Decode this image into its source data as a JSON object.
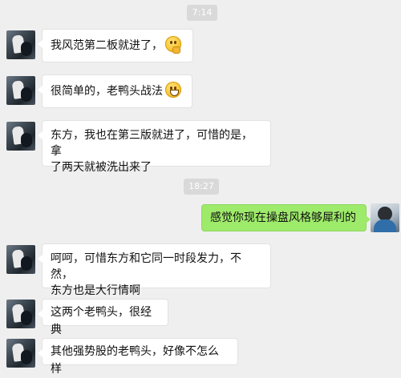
{
  "timestamps": [
    "7:14",
    "18:27"
  ],
  "messages": [
    {
      "sender": "friend",
      "text": "我风范第二板就进了，",
      "emoji": "thinking-face-icon"
    },
    {
      "sender": "friend",
      "text": "很简单的，老鸭头战法",
      "emoji": "grinning-face-icon"
    },
    {
      "sender": "friend",
      "line1": "东方，我也在第三版就进了，可惜的是，拿",
      "line2": "了两天就被洗出来了"
    },
    {
      "sender": "self",
      "text": "感觉你现在操盘风格够犀利的"
    },
    {
      "sender": "friend",
      "line1": "呵呵，可惜东方和它同一时段发力，不然，",
      "line2": "东方也是大行情啊"
    },
    {
      "sender": "friend",
      "text": "这两个老鸭头，很经典"
    },
    {
      "sender": "friend",
      "text": "其他强势股的老鸭头，好像不怎么样"
    }
  ]
}
